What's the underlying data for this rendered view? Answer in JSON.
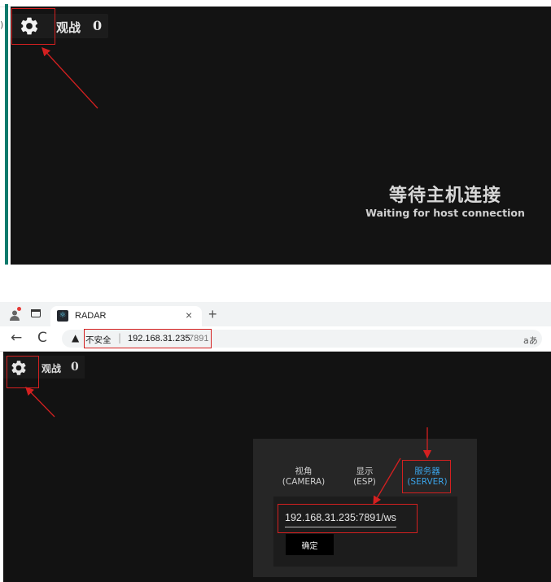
{
  "top_screenshot": {
    "spectate_label": "观战",
    "spectate_count": "0",
    "waiting_cn": "等待主机连接",
    "waiting_en": "Waiting for host connection",
    "left_edge_char": ")"
  },
  "bottom_screenshot": {
    "browser": {
      "tab_title": "RADAR",
      "tab_close": "×",
      "new_tab": "+",
      "back": "←",
      "reload": "C",
      "warning_icon": "▲",
      "insecure_label": "不安全",
      "separator": "|",
      "url_host": "192.168.31.235",
      "url_port": ":7891",
      "translate": "aあ",
      "favicon": "⚛"
    },
    "app": {
      "spectate_label": "观战",
      "spectate_count": "0"
    },
    "settings_panel": {
      "tabs": [
        {
          "line1": "视角",
          "line2": "(CAMERA)"
        },
        {
          "line1": "显示",
          "line2": "(ESP)"
        },
        {
          "line1": "服务器",
          "line2": "(SERVER)"
        }
      ],
      "active_tab": "服务器",
      "server_address": "192.168.31.235:7891/ws",
      "confirm_label": "确定"
    }
  },
  "colors": {
    "app_bg": "#131313",
    "panel_bg": "#262626",
    "active_tab": "#3aa3e8",
    "annotation": "#d42020",
    "teal_edge": "#0e7a6c"
  }
}
